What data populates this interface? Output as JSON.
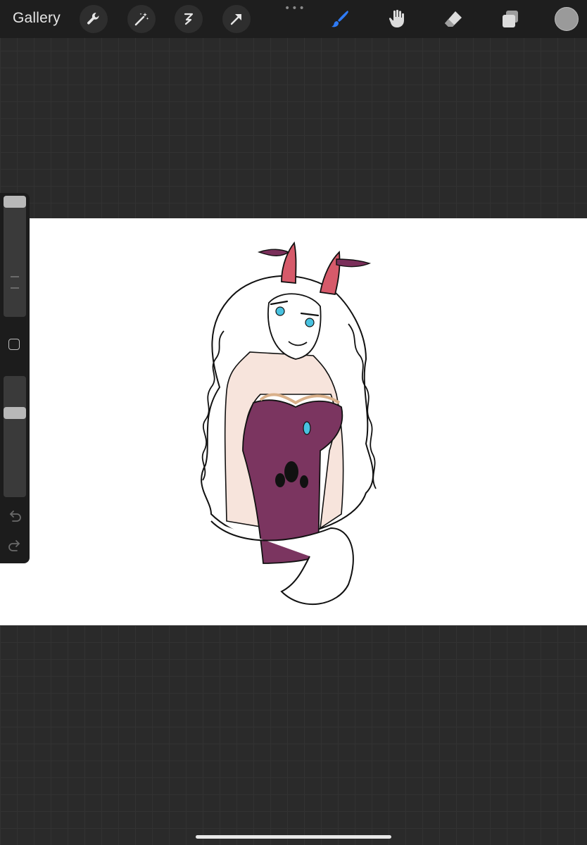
{
  "app": {
    "gallery_label": "Gallery"
  },
  "toolbar": {
    "left_tools": [
      "wrench-icon",
      "magic-wand-icon",
      "selection-icon",
      "transform-arrow-icon"
    ],
    "more_glyph": "•••",
    "right_tools": [
      "brush-icon",
      "smudge-icon",
      "eraser-icon",
      "layers-icon"
    ],
    "active_tool": "brush",
    "accent_color": "#2f7bf5",
    "current_color": "#9a9a9a"
  },
  "sidebar": {
    "brush_size": 0.0,
    "brush_opacity": 0.82
  },
  "canvas": {
    "background": "#ffffff"
  }
}
